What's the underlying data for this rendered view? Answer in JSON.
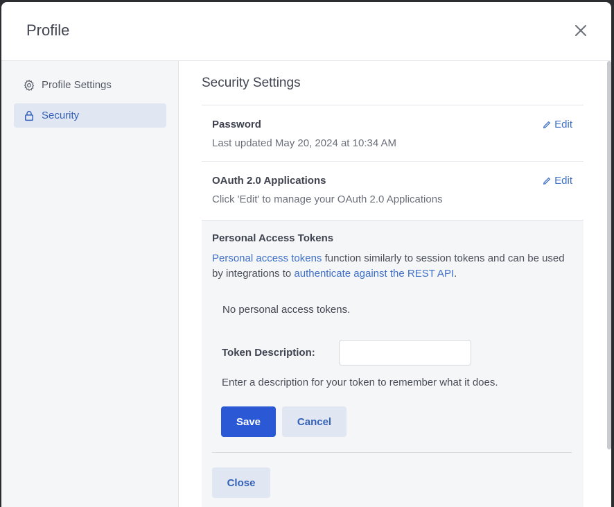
{
  "modal": {
    "title": "Profile",
    "close_icon": "close-icon"
  },
  "sidebar": {
    "items": [
      {
        "label": "Profile Settings",
        "icon": "gear-icon",
        "active": false
      },
      {
        "label": "Security",
        "icon": "lock-icon",
        "active": true
      }
    ]
  },
  "content": {
    "section_title": "Security Settings",
    "password": {
      "title": "Password",
      "subtitle": "Last updated May 20, 2024 at 10:34 AM",
      "edit_label": "Edit"
    },
    "oauth": {
      "title": "OAuth 2.0 Applications",
      "subtitle": "Click 'Edit' to manage your OAuth 2.0 Applications",
      "edit_label": "Edit"
    },
    "tokens": {
      "title": "Personal Access Tokens",
      "desc_link1": "Personal access tokens",
      "desc_text1": " function similarly to session tokens and can be used by integrations to ",
      "desc_link2": "authenticate against the REST API",
      "desc_text2": ".",
      "empty_text": "No personal access tokens.",
      "token_label": "Token Description:",
      "token_value": "",
      "hint": "Enter a description for your token to remember what it does.",
      "save_label": "Save",
      "cancel_label": "Cancel"
    },
    "close_label": "Close"
  },
  "colors": {
    "accent": "#2b59d6",
    "link": "#3e6fc7",
    "active_bg": "#e1e6f3"
  }
}
